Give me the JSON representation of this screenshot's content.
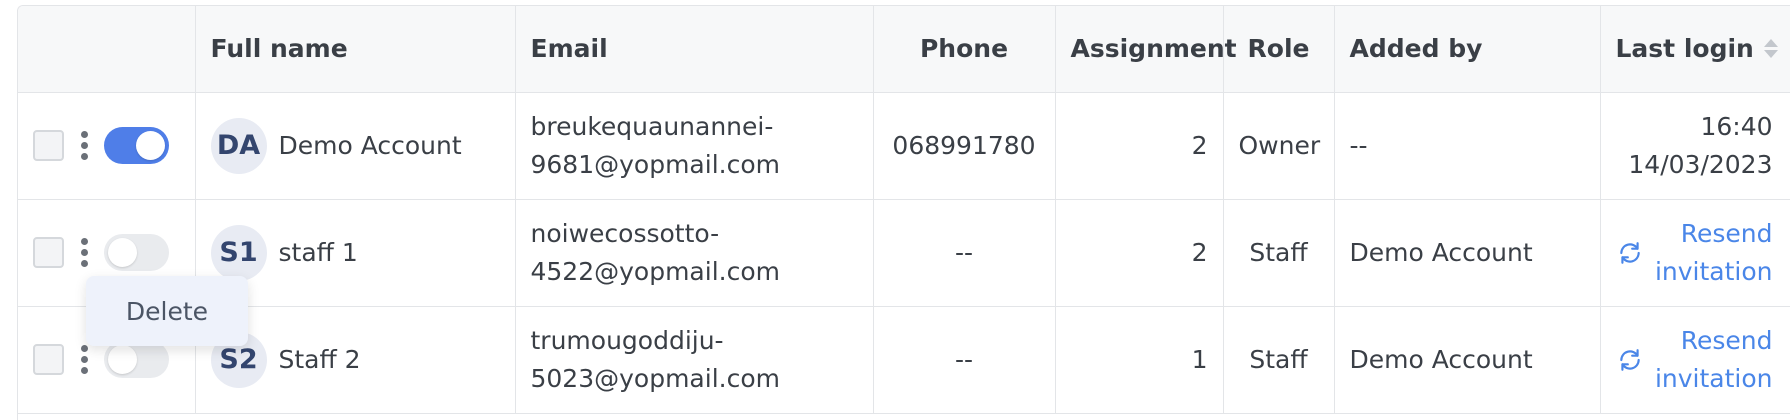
{
  "table": {
    "headers": {
      "full_name": "Full name",
      "email": "Email",
      "phone": "Phone",
      "assignment": "Assignment",
      "role": "Role",
      "added_by": "Added by",
      "last_login": "Last login"
    },
    "rows": [
      {
        "avatar": "DA",
        "name": "Demo Account",
        "email_line1": "breukequaunannei-",
        "email_line2": "9681@yopmail.com",
        "phone": "068991780",
        "assignment": "2",
        "role": "Owner",
        "added_by": "--",
        "last_login_time": "16:40",
        "last_login_date": "14/03/2023",
        "active": true
      },
      {
        "avatar": "S1",
        "name": "staff 1",
        "email_line1": "noiwecossotto-",
        "email_line2": "4522@yopmail.com",
        "phone": "--",
        "assignment": "2",
        "role": "Staff",
        "added_by": "Demo Account",
        "resend_line1": "Resend",
        "resend_line2": "invitation",
        "active": false
      },
      {
        "avatar": "S2",
        "name": "Staff 2",
        "email_line1": "trumougoddiju-",
        "email_line2": "5023@yopmail.com",
        "phone": "--",
        "assignment": "1",
        "role": "Staff",
        "added_by": "Demo Account",
        "resend_line1": "Resend",
        "resend_line2": "invitation",
        "active": false
      }
    ]
  },
  "context_menu": {
    "delete_label": "Delete"
  },
  "icons": {
    "kebab": "more-vertical-icon",
    "refresh": "refresh-icon",
    "sort": "sort-icon"
  },
  "colors": {
    "accent": "#4f7ee8",
    "link": "#4a86e8",
    "header_bg": "#f7f8f9",
    "border": "#e3e5e8"
  }
}
